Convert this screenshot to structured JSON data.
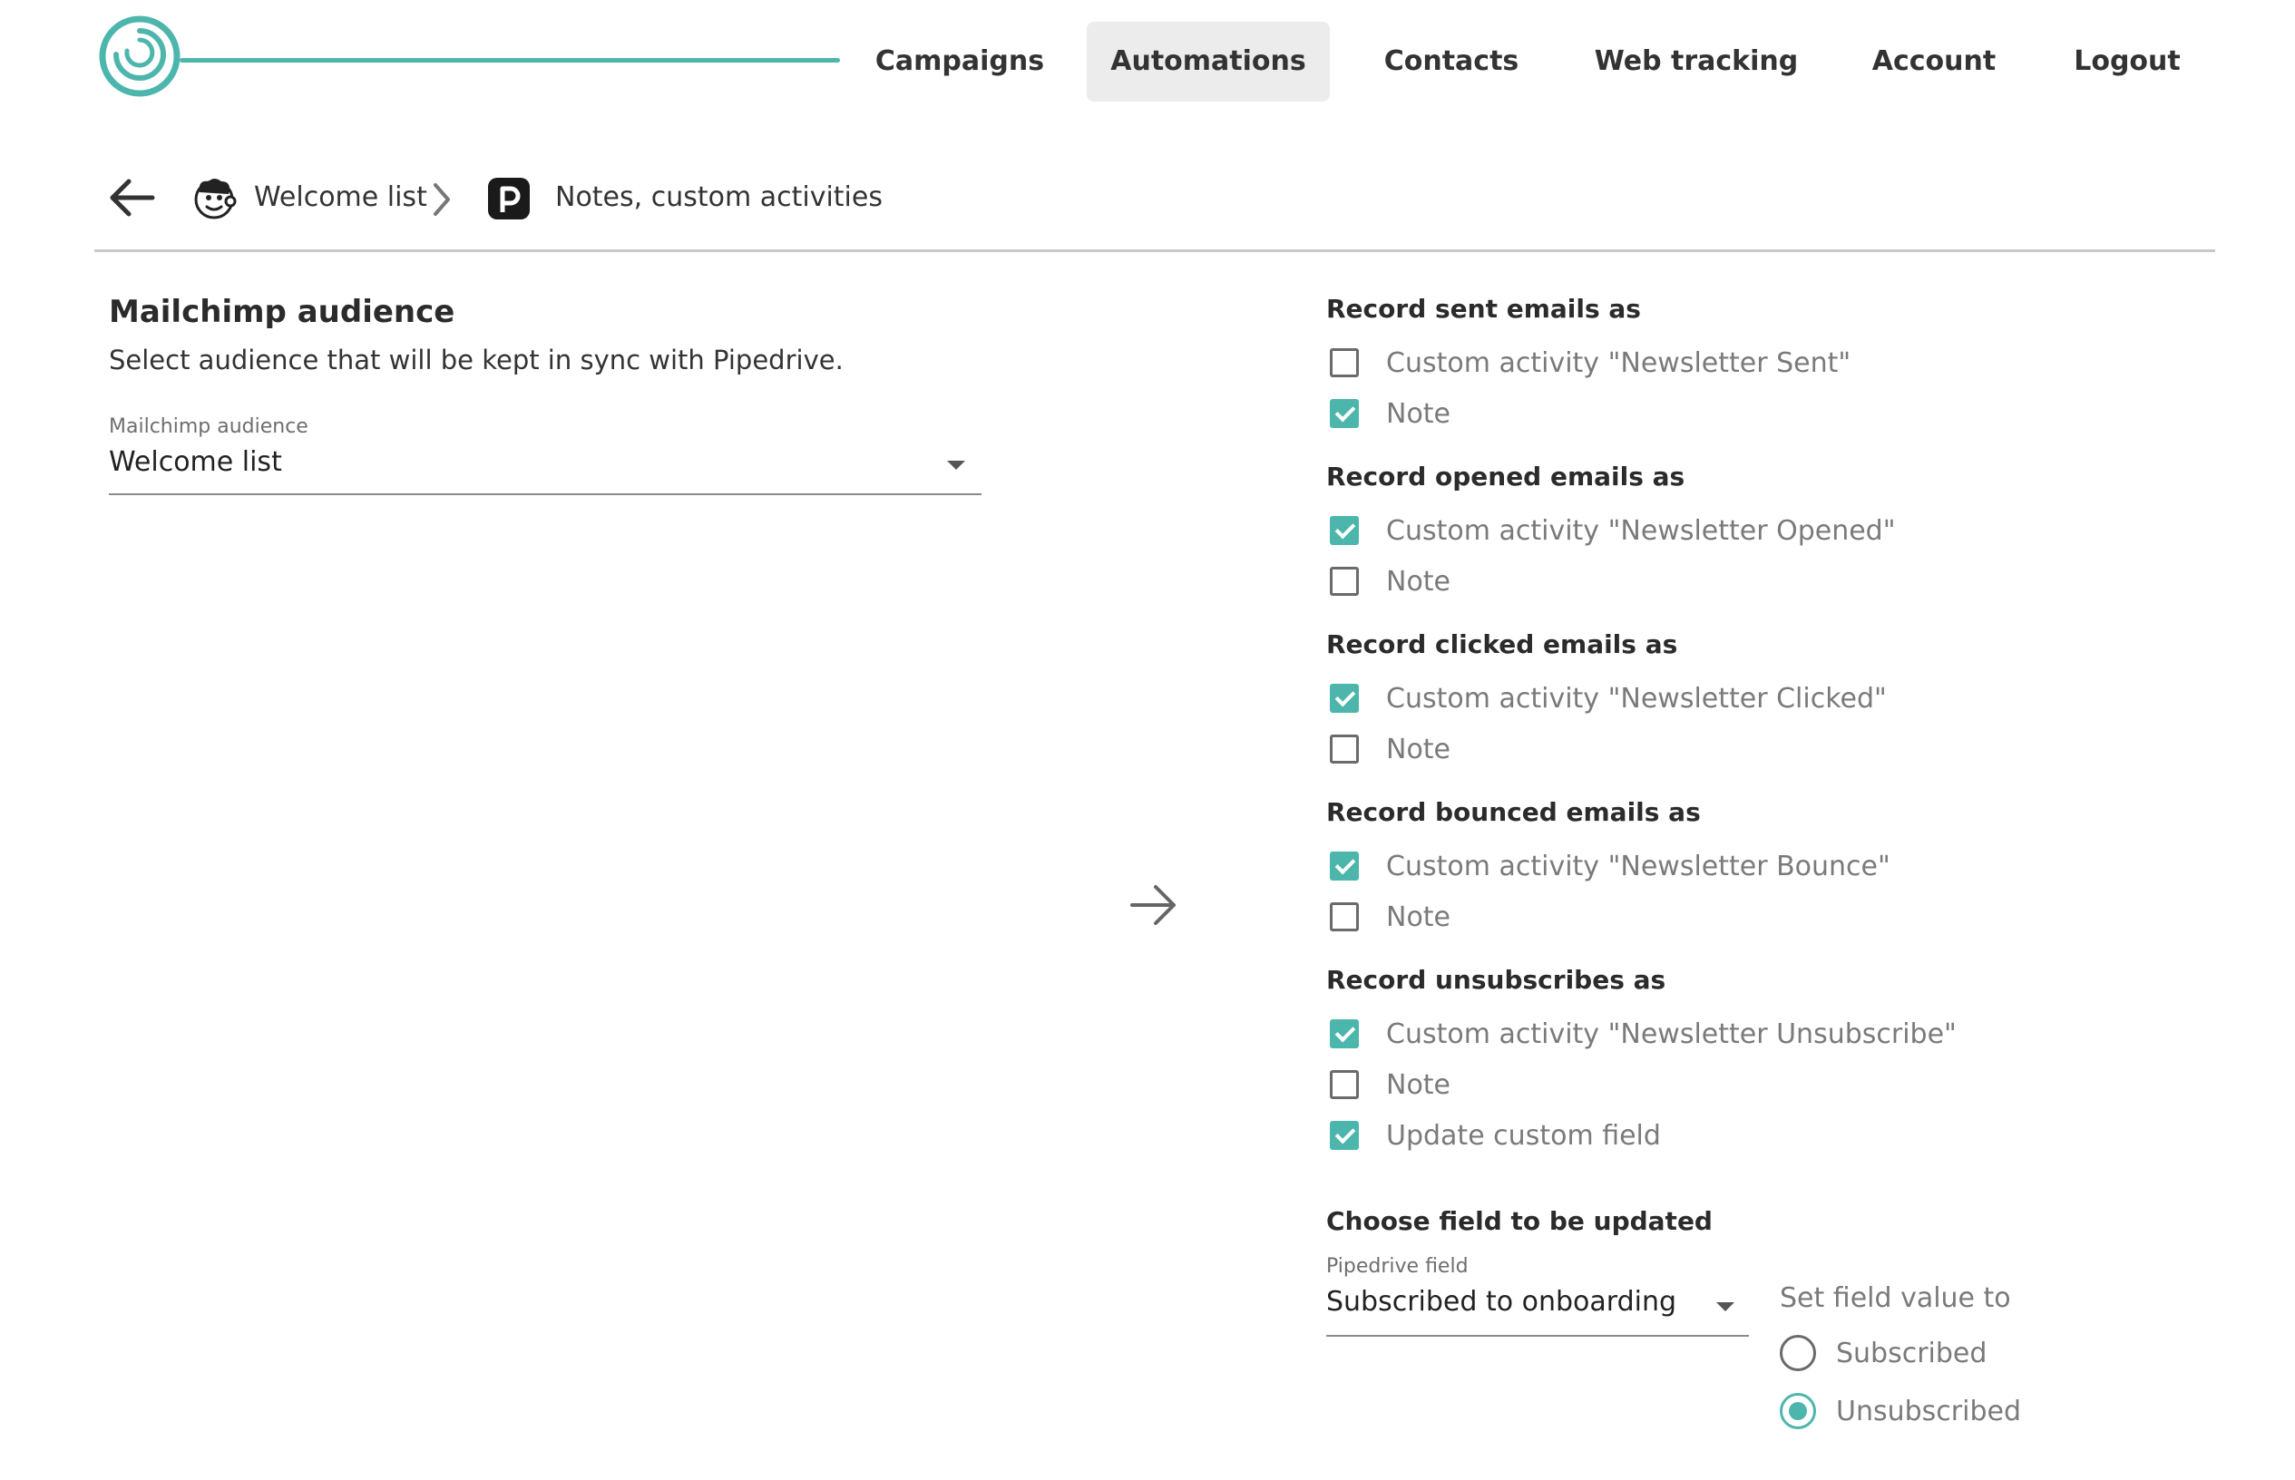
{
  "nav": {
    "items": [
      {
        "label": "Campaigns",
        "active": false
      },
      {
        "label": "Automations",
        "active": true
      },
      {
        "label": "Contacts",
        "active": false
      },
      {
        "label": "Web tracking",
        "active": false
      },
      {
        "label": "Account",
        "active": false
      },
      {
        "label": "Logout",
        "active": false
      }
    ]
  },
  "breadcrumb": {
    "back_icon": "arrow-left-icon",
    "source": {
      "icon": "mailchimp-icon",
      "label": "Welcome list"
    },
    "separator_icon": "chevron-right-icon",
    "target": {
      "icon": "pipedrive-icon",
      "label": "Notes, custom activities"
    }
  },
  "audience": {
    "title": "Mailchimp audience",
    "description": "Select audience that will be kept in sync with Pipedrive.",
    "field_label": "Mailchimp audience",
    "value": "Welcome list"
  },
  "mapping_icon": "arrow-right-icon",
  "record_groups": {
    "sent": {
      "title": "Record sent emails as",
      "options": [
        {
          "label": "Custom activity \"Newsletter Sent\"",
          "checked": false
        },
        {
          "label": "Note",
          "checked": true
        }
      ]
    },
    "opened": {
      "title": "Record opened emails as",
      "options": [
        {
          "label": "Custom activity \"Newsletter Opened\"",
          "checked": true
        },
        {
          "label": "Note",
          "checked": false
        }
      ]
    },
    "clicked": {
      "title": "Record clicked emails as",
      "options": [
        {
          "label": "Custom activity \"Newsletter Clicked\"",
          "checked": true
        },
        {
          "label": "Note",
          "checked": false
        }
      ]
    },
    "bounced": {
      "title": "Record bounced emails as",
      "options": [
        {
          "label": "Custom activity \"Newsletter Bounce\"",
          "checked": true
        },
        {
          "label": "Note",
          "checked": false
        }
      ]
    },
    "unsubscribes": {
      "title": "Record unsubscribes as",
      "options": [
        {
          "label": "Custom activity \"Newsletter Unsubscribe\"",
          "checked": true
        },
        {
          "label": "Note",
          "checked": false
        },
        {
          "label": "Update custom field",
          "checked": true
        }
      ]
    }
  },
  "field_update": {
    "title": "Choose field to be updated",
    "field_label": "Pipedrive field",
    "value": "Subscribed to onboarding",
    "set_value_label": "Set field value to",
    "options": [
      {
        "label": "Subscribed",
        "selected": false
      },
      {
        "label": "Unsubscribed",
        "selected": true
      }
    ]
  },
  "colors": {
    "accent": "#4db6ac",
    "nav_active_bg": "#ececec",
    "text": "#2b2b2b",
    "muted": "#7a7a7a"
  }
}
